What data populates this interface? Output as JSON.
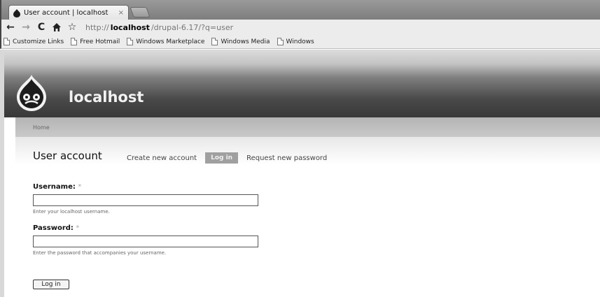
{
  "browser": {
    "tab_title": "User account | localhost",
    "tab_close": "×",
    "url": {
      "scheme": "http://",
      "host": "localhost",
      "path": "/drupal-6.17/?q=user"
    },
    "bookmarks": [
      "Customize Links",
      "Free Hotmail",
      "Windows Marketplace",
      "Windows Media",
      "Windows"
    ]
  },
  "site": {
    "name": "localhost",
    "breadcrumb": "Home"
  },
  "main": {
    "title": "User account",
    "tabs": [
      {
        "label": "Create new account",
        "active": false
      },
      {
        "label": "Log in",
        "active": true
      },
      {
        "label": "Request new password",
        "active": false
      }
    ],
    "form": {
      "username_label": "Username:",
      "username_value": "",
      "username_hint": "Enter your localhost username.",
      "password_label": "Password:",
      "password_value": "",
      "password_hint": "Enter the password that accompanies your username.",
      "required_marker": "*",
      "submit_label": "Log in"
    }
  },
  "icons": {
    "back": "back-arrow-icon",
    "forward": "forward-arrow-icon",
    "reload": "reload-icon",
    "home": "home-icon",
    "bookmark_star": "star-icon",
    "drupal_logo": "drupal-drop-logo"
  },
  "colors": {
    "header_dark": "#383838",
    "header_light": "#dcdcdc",
    "tab_active_bg": "#a0a0a0",
    "site_name": "#f2f2f2"
  }
}
